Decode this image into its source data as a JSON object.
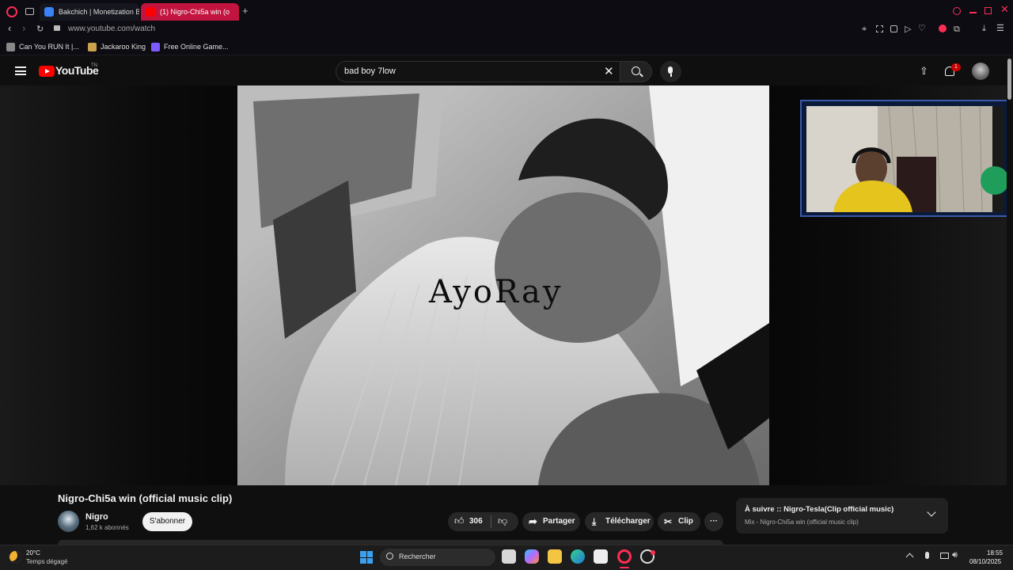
{
  "browser": {
    "tabs": [
      {
        "title": "Bakchich | Monetization B",
        "favicon_color": "#3b82f6"
      },
      {
        "title": "(1) Nigro-Chi5a win (o",
        "favicon_color": "#ff0000",
        "active": true
      }
    ],
    "address": "www.youtube.com/watch",
    "bookmarks": [
      {
        "label": "Can You RUN It |...",
        "icon_color": "#888888"
      },
      {
        "label": "Jackaroo King",
        "icon_color": "#c9a24b"
      },
      {
        "label": "Free Online Game...",
        "icon_color": "#7c5cff"
      }
    ],
    "accent": "#ff2d55"
  },
  "youtube": {
    "logo_text": "YouTube",
    "logo_sup": "TN",
    "search_value": "bad boy 7low",
    "notification_count": "1"
  },
  "video": {
    "watermark": "AyoRay",
    "title": "Nigro-Chi5a win (official music clip)",
    "channel": "Nigro",
    "subscribers": "1,62 k abonnés",
    "subscribe_label": "S'abonner",
    "likes": "306",
    "share_label": "Partager",
    "download_label": "Télécharger",
    "clip_label": "Clip",
    "more_label": "···"
  },
  "up_next": {
    "title": "À suivre :: Nigro-Tesla(Clip official music)",
    "subtitle": "Mix - Nigro-Chi5a win (official music clip)"
  },
  "taskbar": {
    "weather_temp": "20°C",
    "weather_desc": "Temps dégagé",
    "search_label": "Rechercher",
    "time": "18:55",
    "date": "08/10/2025"
  }
}
